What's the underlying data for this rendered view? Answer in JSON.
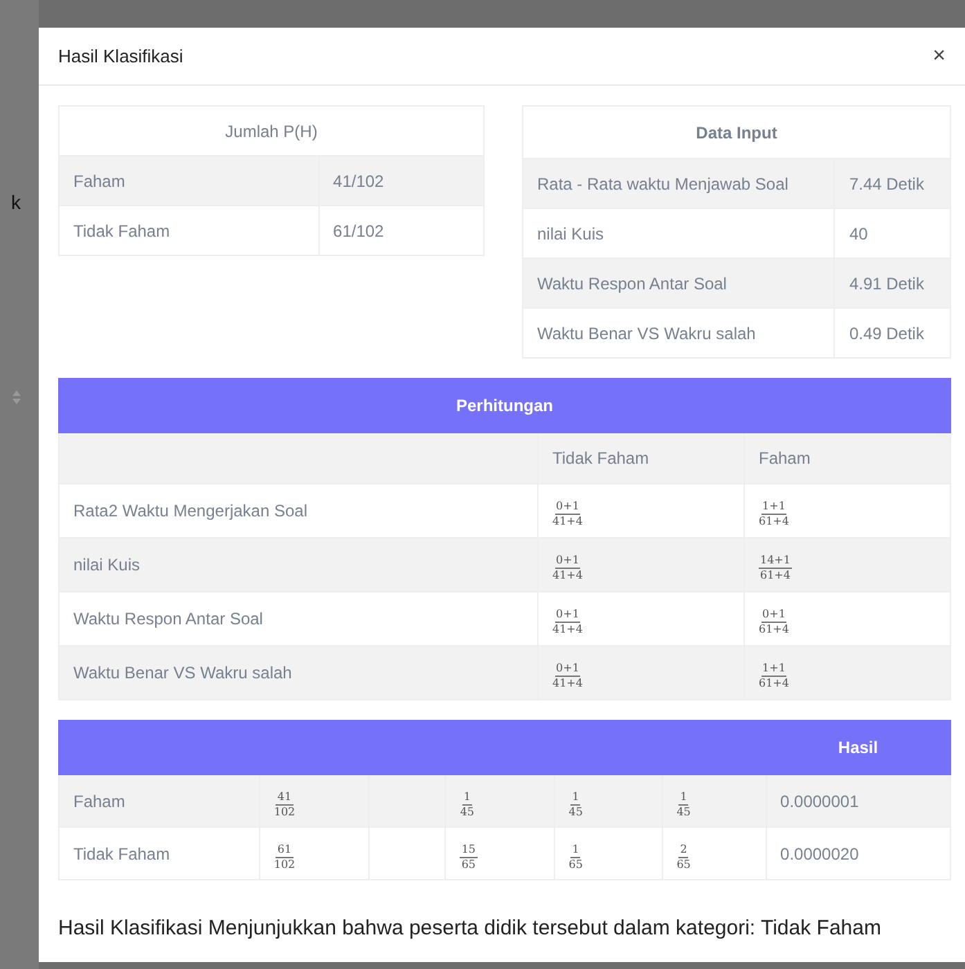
{
  "backdrop": {
    "fragment": "k"
  },
  "modal": {
    "title": "Hasil Klasifikasi",
    "close": "×"
  },
  "prior_table": {
    "heading": "Jumlah P(H)",
    "rows": [
      {
        "label": "Faham",
        "value": "41/102"
      },
      {
        "label": "Tidak Faham",
        "value": "61/102"
      }
    ]
  },
  "input_table": {
    "heading": "Data Input",
    "rows": [
      {
        "label": "Rata - Rata waktu Menjawab Soal",
        "value": "7.44 Detik"
      },
      {
        "label": "nilai Kuis",
        "value": "40"
      },
      {
        "label": "Waktu Respon Antar Soal",
        "value": "4.91 Detik"
      },
      {
        "label": "Waktu Benar VS Wakru salah",
        "value": "0.49 Detik"
      }
    ]
  },
  "calc_table": {
    "heading": "Perhitungan",
    "columns": [
      "Tidak Faham",
      "Faham"
    ],
    "rows": [
      {
        "label": "Rata2 Waktu Mengerjakan Soal",
        "cells": [
          {
            "num": "0+1",
            "den": "41+4"
          },
          {
            "num": "1+1",
            "den": "61+4"
          }
        ]
      },
      {
        "label": "nilai Kuis",
        "cells": [
          {
            "num": "0+1",
            "den": "41+4"
          },
          {
            "num": "14+1",
            "den": "61+4"
          }
        ]
      },
      {
        "label": "Waktu Respon Antar Soal",
        "cells": [
          {
            "num": "0+1",
            "den": "41+4"
          },
          {
            "num": "0+1",
            "den": "61+4"
          }
        ]
      },
      {
        "label": "Waktu Benar VS Wakru salah",
        "cells": [
          {
            "num": "0+1",
            "den": "41+4"
          },
          {
            "num": "1+1",
            "den": "61+4"
          }
        ]
      }
    ]
  },
  "result_table": {
    "heading": "Hasil",
    "rows": [
      {
        "label": "Faham",
        "cells": [
          {
            "kind": "fraction",
            "num": "41",
            "den": "102"
          },
          {
            "kind": "empty"
          },
          {
            "kind": "fraction",
            "num": "1",
            "den": "45"
          },
          {
            "kind": "fraction",
            "num": "1",
            "den": "45"
          },
          {
            "kind": "fraction",
            "num": "1",
            "den": "45"
          }
        ],
        "result": "0.0000001"
      },
      {
        "label": "Tidak Faham",
        "cells": [
          {
            "kind": "fraction",
            "num": "61",
            "den": "102"
          },
          {
            "kind": "empty"
          },
          {
            "kind": "fraction",
            "num": "15",
            "den": "65"
          },
          {
            "kind": "fraction",
            "num": "1",
            "den": "65"
          },
          {
            "kind": "fraction",
            "num": "2",
            "den": "65"
          }
        ],
        "result": "0.0000020"
      }
    ]
  },
  "conclusion": "Hasil Klasifikasi Menjunjukkan bahwa peserta didik tersebut dalam kategori: Tidak Faham"
}
